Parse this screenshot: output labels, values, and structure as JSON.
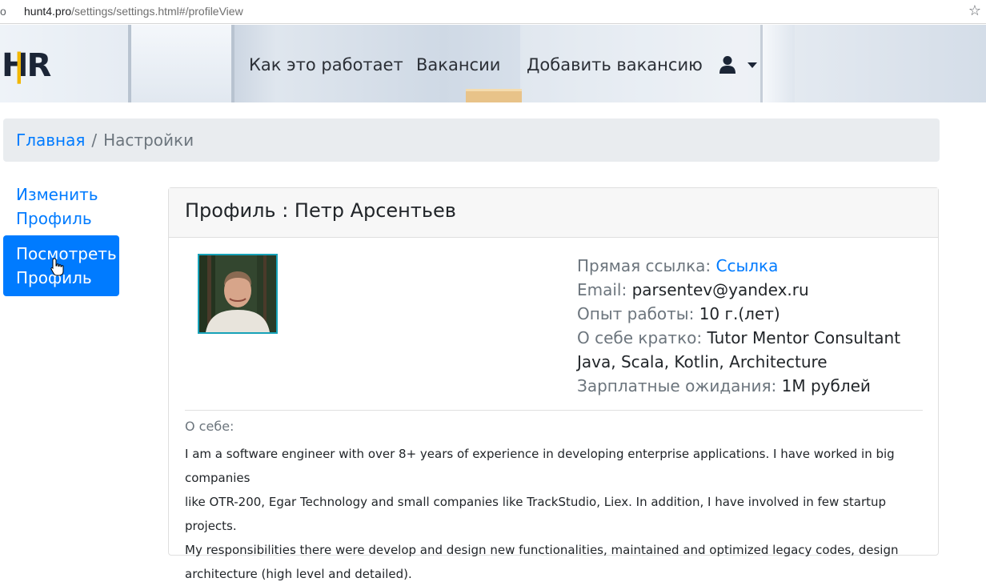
{
  "browser": {
    "left_glyph": "o",
    "url_host": "hunt4.pro",
    "url_path": "/settings/settings.html#/profileView"
  },
  "header": {
    "logo_h": "H",
    "logo_r": "R",
    "nav": [
      {
        "label": "Как это работает"
      },
      {
        "label": "Вакансии"
      },
      {
        "label": "Добавить вакансию"
      }
    ],
    "user_icon": "user-icon"
  },
  "breadcrumb": {
    "home": "Главная",
    "separator": "/",
    "current": "Настройки"
  },
  "sidebar": {
    "edit_line1": "Изменить",
    "edit_line2": "Профиль",
    "view_line1": "Посмотреть",
    "view_line2": "Профиль"
  },
  "profile": {
    "title": "Профиль : Петр Арсентьев",
    "direct_link_label": "Прямая ссылка:",
    "direct_link_value": "Ссылка",
    "email_label": "Email:",
    "email_value": "parsentev@yandex.ru",
    "experience_label": "Опыт работы:",
    "experience_value": "10 г.(лет)",
    "about_short_label": "О себе кратко:",
    "about_short_value_line1": "Tutor Mentor Consultant",
    "about_short_value_line2": "Java, Scala, Kotlin, Architecture",
    "salary_label": "Зарплатные ожидания:",
    "salary_value": "1M рублей",
    "about_label": "О себе:",
    "about_lines": [
      "I am a software engineer with over 8+ years of experience in developing enterprise applications. I have worked in big companies",
      "like OTR-200, Egar Technology and small companies like TrackStudio, Liex. In addition, I have involved in few startup projects.",
      "My responsibilities there were develop and design new functionalities, maintained and optimized legacy codes, design",
      "architecture (high level and detailed)."
    ]
  },
  "colors": {
    "primary": "#007bff",
    "muted": "#6c757d",
    "logo_accent": "#f2b705"
  }
}
